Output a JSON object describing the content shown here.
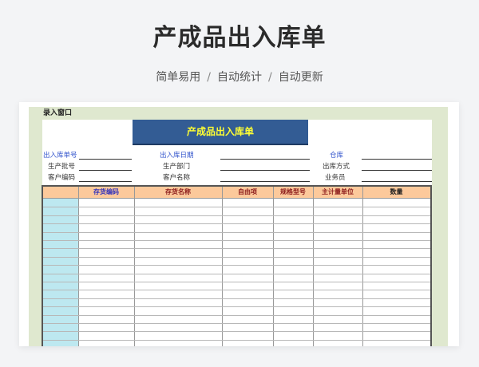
{
  "header": {
    "title": "产成品出入库单",
    "subtitle_items": [
      "简单易用",
      "自动统计",
      "自动更新"
    ],
    "separator": "/"
  },
  "window": {
    "bar_label": "录入窗口",
    "form_title": "产成品出入库单"
  },
  "form": {
    "left": [
      "出入库单号",
      "生产批号",
      "客户编码"
    ],
    "middle": [
      "出入库日期",
      "生产部门",
      "客户名称"
    ],
    "right": [
      "仓库",
      "出库方式",
      "业务员"
    ]
  },
  "table": {
    "columns": [
      "",
      "存货编码",
      "存货名称",
      "自由项",
      "规格型号",
      "主计量单位",
      "数量"
    ],
    "row_count": 18
  },
  "colors": {
    "title_bar": "#335c94",
    "title_text": "#ffff33",
    "window_bg": "#dfe8cf",
    "header_bg": "#fcc99b",
    "row_index_bg": "#bde8f0"
  }
}
